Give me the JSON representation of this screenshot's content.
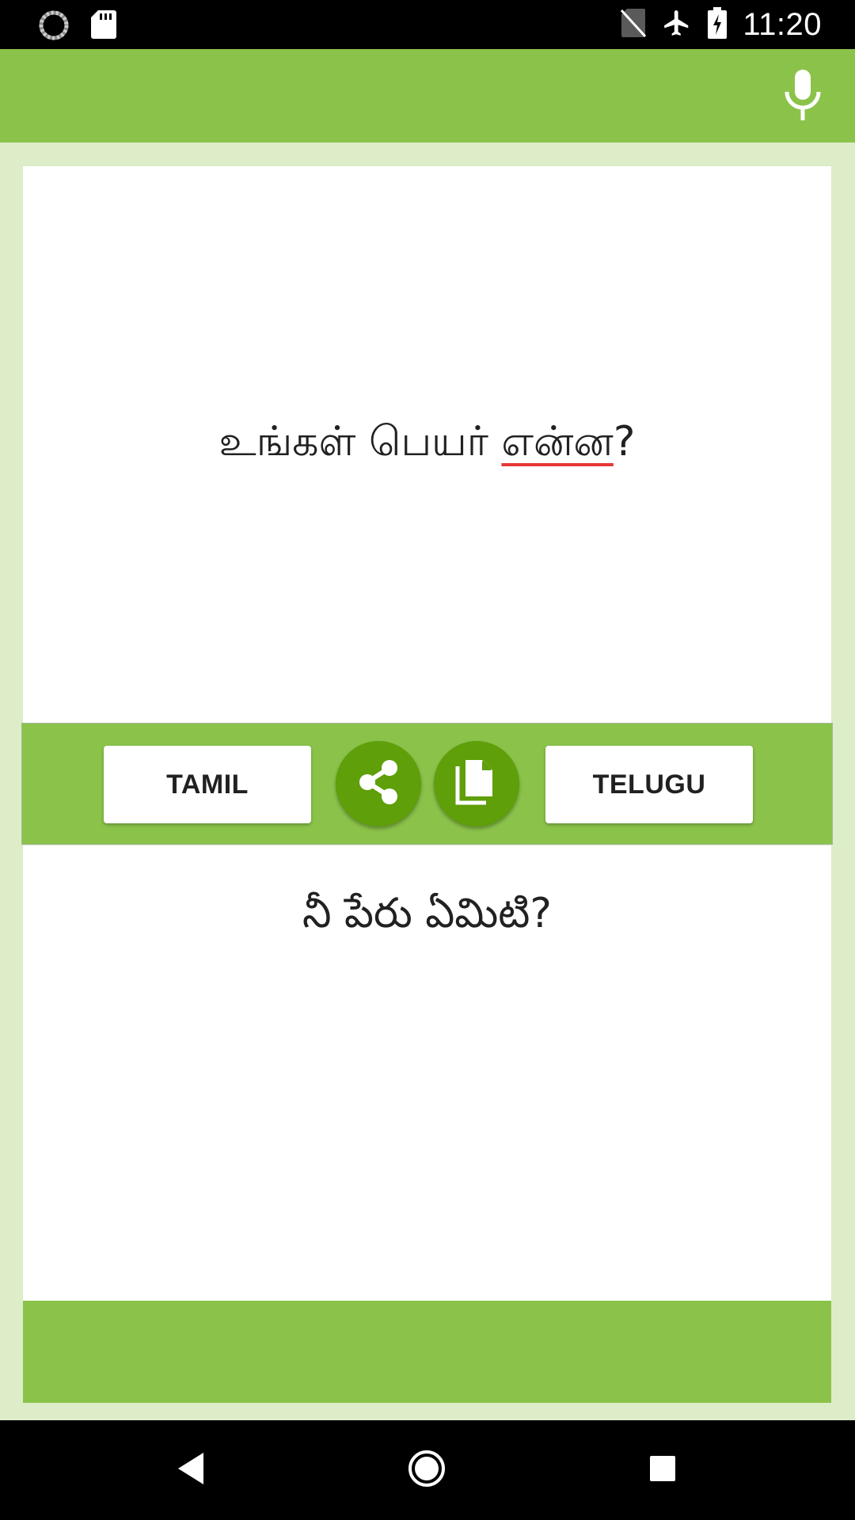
{
  "status_bar": {
    "time": "11:20",
    "icons": [
      "sync-icon",
      "sd-card-icon",
      "no-sim-icon",
      "airplane-mode-icon",
      "battery-charging-icon"
    ]
  },
  "app_bar": {
    "actions": [
      "microphone-icon"
    ]
  },
  "source_panel": {
    "text_before": "உங்கள் பெயர் ",
    "misspelled_word": "என்ன",
    "text_after": "?"
  },
  "controls": {
    "source_language": "TAMIL",
    "target_language": "TELUGU",
    "share_icon": "share-icon",
    "copy_icon": "copy-icon"
  },
  "target_panel": {
    "text": "నీ పేరు ఏమిటి?"
  },
  "colors": {
    "primary": "#8bc34a",
    "accent_button": "#5e9f0a",
    "background": "#dcedc8",
    "spell_underline": "#e53935"
  },
  "nav_bar": {
    "icons": [
      "back-icon",
      "home-icon",
      "recents-icon"
    ]
  }
}
